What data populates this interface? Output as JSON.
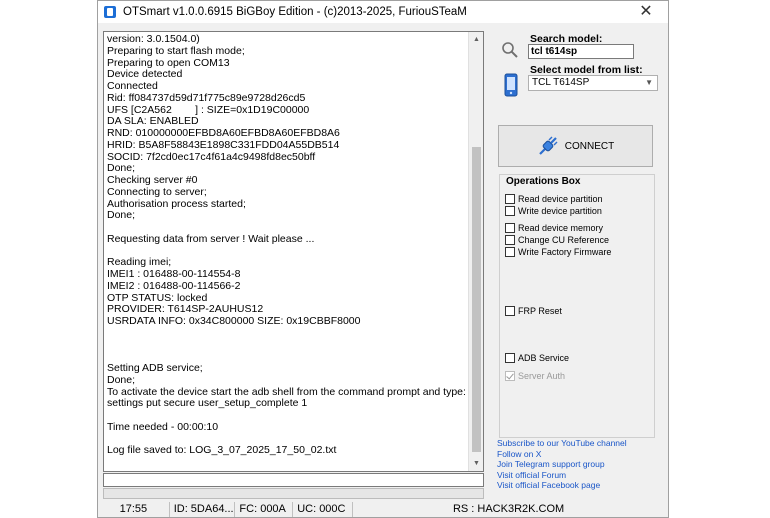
{
  "window": {
    "title": "OTSmart  v1.0.0.6915 BiGBoy Edition - (c)2013-2025, FuriouSTeaM",
    "close_glyph": "✕"
  },
  "log": {
    "lines": [
      "version: 3.0.1504.0)",
      "Preparing to start flash mode;",
      "Preparing to open COM13",
      "Device detected",
      "Connected",
      "Rid: ff084737d59d71f775c89e9728d26cd5",
      "UFS [C2A562        ] : SIZE=0x1D19C00000",
      "DA SLA: ENABLED",
      "RND: 010000000EFBD8A60EFBD8A60EFBD8A6",
      "HRID: B5A8F58843E1898C331FDD04A55DB514",
      "SOCID: 7f2cd0ec17c4f61a4c9498fd8ec50bff",
      "Done;",
      "Checking server #0",
      "Connecting to server;",
      "Authorisation process started;",
      "Done;",
      "",
      "Requesting data from server ! Wait please ...",
      "",
      "Reading imei;",
      "IMEI1 : 016488-00-114554-8",
      "IMEI2 : 016488-00-114566-2",
      "OTP STATUS: locked",
      "PROVIDER: T614SP-2AUHUS12",
      "USRDATA INFO: 0x34C800000 SIZE: 0x19CBBF8000",
      "",
      "",
      "",
      "Setting ADB service;",
      "Done;",
      "To activate the device start the adb shell from the command prompt and type:",
      "settings put secure user_setup_complete 1",
      "",
      "Time needed - 00:00:10",
      "",
      "Log file saved to: LOG_3_07_2025_17_50_02.txt"
    ]
  },
  "search": {
    "label": "Search model:",
    "value": "tcl t614sp"
  },
  "model_select": {
    "label": "Select model from list:",
    "selected": "TCL T614SP"
  },
  "connect": {
    "label": "CONNECT"
  },
  "operations": {
    "title": "Operations Box",
    "items": [
      {
        "label": "Read device partition",
        "checked": false,
        "disabled": false
      },
      {
        "label": "Write device partition",
        "checked": false,
        "disabled": false
      },
      {
        "label": "Read device memory",
        "checked": false,
        "disabled": false
      },
      {
        "label": "Change CU Reference",
        "checked": false,
        "disabled": false
      },
      {
        "label": "Write Factory Firmware",
        "checked": false,
        "disabled": false
      },
      {
        "label": "FRP Reset",
        "checked": false,
        "disabled": false
      },
      {
        "label": "ADB Service",
        "checked": false,
        "disabled": false
      },
      {
        "label": "Server Auth",
        "checked": true,
        "disabled": true
      }
    ]
  },
  "links": [
    "Subscribe to our YouTube channel",
    "Follow on X",
    "Join Telegram support group",
    "Visit official Forum",
    "Visit official Facebook page"
  ],
  "status": {
    "time": "17:55",
    "id": "ID: 5DA64...",
    "fc": "FC: 000A",
    "uc": "UC: 000C",
    "rs": "RS : HACK3R2K.COM"
  },
  "colors": {
    "link": "#1a56c8",
    "window_bg": "#f0f0f0",
    "accent_icon": "#1c6ed6"
  },
  "icons": {
    "app": "app-icon",
    "search": "magnifier-icon",
    "phone": "phone-icon",
    "connect": "plug-icon"
  }
}
